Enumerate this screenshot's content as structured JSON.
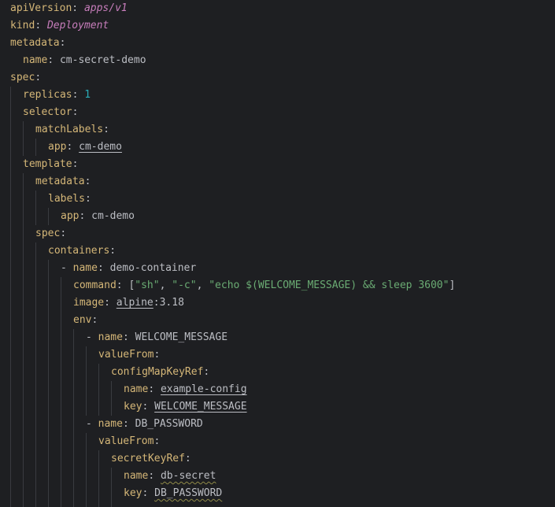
{
  "colors": {
    "background": "#1e1f22",
    "key": "#d5b778",
    "italic_value": "#c77dbb",
    "number": "#2aacb8",
    "string": "#6aab73",
    "plain": "#bcbec4",
    "indent_guide": "#393b40"
  },
  "lines": [
    {
      "k": "apiVersion",
      "v": "apps/v1"
    },
    {
      "k": "kind",
      "v": "Deployment"
    },
    {
      "k": "metadata"
    },
    {
      "k": "name",
      "v": "cm-secret-demo"
    },
    {
      "k": "spec"
    },
    {
      "k": "replicas",
      "v": "1"
    },
    {
      "k": "selector"
    },
    {
      "k": "matchLabels"
    },
    {
      "k": "app",
      "v": "cm-demo"
    },
    {
      "k": "template"
    },
    {
      "k": "metadata"
    },
    {
      "k": "labels"
    },
    {
      "k": "app",
      "v": "cm-demo"
    },
    {
      "k": "spec"
    },
    {
      "k": "containers"
    },
    {
      "k": "name",
      "v": "demo-container"
    },
    {
      "k": "command",
      "v": [
        "sh",
        "-c",
        "echo $(WELCOME_MESSAGE) && sleep 3600"
      ]
    },
    {
      "k": "image",
      "v1": "alpine",
      "v2": ":3.18"
    },
    {
      "k": "env"
    },
    {
      "k": "name",
      "v": "WELCOME_MESSAGE"
    },
    {
      "k": "valueFrom"
    },
    {
      "k": "configMapKeyRef"
    },
    {
      "k": "name",
      "v": "example-config"
    },
    {
      "k": "key",
      "v": "WELCOME_MESSAGE"
    },
    {
      "k": "name",
      "v": "DB_PASSWORD"
    },
    {
      "k": "valueFrom"
    },
    {
      "k": "secretKeyRef"
    },
    {
      "k": "name",
      "v": "db-secret"
    },
    {
      "k": "key",
      "v": "DB_PASSWORD"
    }
  ]
}
